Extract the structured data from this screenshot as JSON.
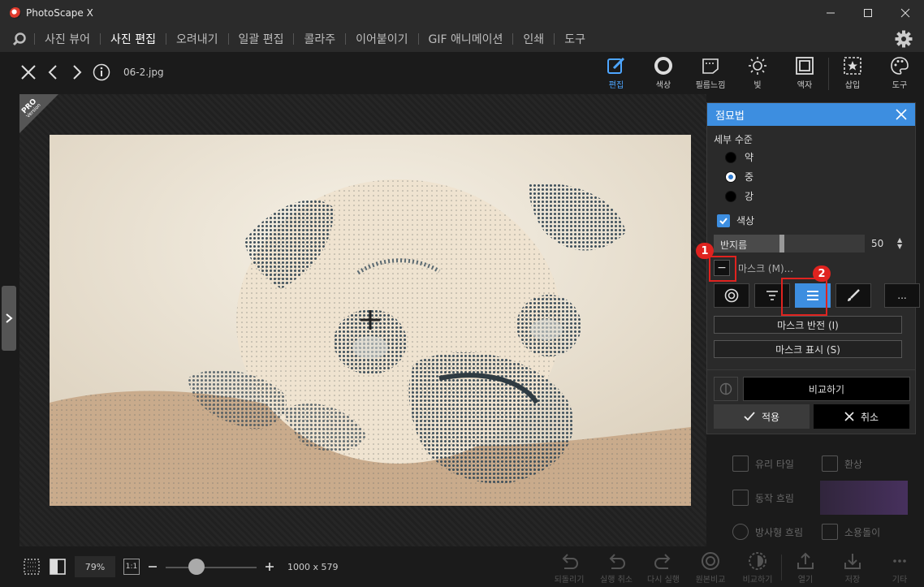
{
  "app": {
    "title": "PhotoScape X"
  },
  "menu": {
    "items": [
      "사진 뷰어",
      "사진 편집",
      "오려내기",
      "일괄 편집",
      "콜라주",
      "이어붙이기",
      "GIF 애니메이션",
      "인쇄",
      "도구"
    ],
    "active": "사진 편집"
  },
  "toolbar": {
    "filename": "06-2.jpg",
    "tools": [
      "편집",
      "색상",
      "필름느낌",
      "빛",
      "액자",
      "삽입",
      "도구"
    ]
  },
  "badge": {
    "pro": "PRO",
    "version": "Version"
  },
  "panel": {
    "title": "점묘법",
    "detail_label": "세부 수준",
    "options": [
      "약",
      "중",
      "강"
    ],
    "selected_option": "중",
    "color_label": "색상",
    "color_checked": true,
    "radius_label": "반지름",
    "radius_value": "50",
    "radius_fraction": 0.45,
    "mask_label": "마스크 (M)...",
    "more_label": "...",
    "invert_mask": "마스크 반전 (I)",
    "show_mask": "마스크 표시 (S)",
    "compare": "비교하기",
    "apply": "적용",
    "cancel": "취소"
  },
  "effects_behind": [
    "유리 타일",
    "환상",
    "동작 흐림",
    "방사형 흐림",
    "소용돌이"
  ],
  "annotations": [
    "1",
    "2"
  ],
  "bottom": {
    "zoom": "79%",
    "one_to_one": "1:1",
    "dimensions": "1000 x 579",
    "zoom_level": 0.3,
    "actions": [
      "되돌리기",
      "실행 취소",
      "다시 실행",
      "원본비교",
      "비교하기",
      "열기",
      "저장",
      "기타"
    ]
  }
}
